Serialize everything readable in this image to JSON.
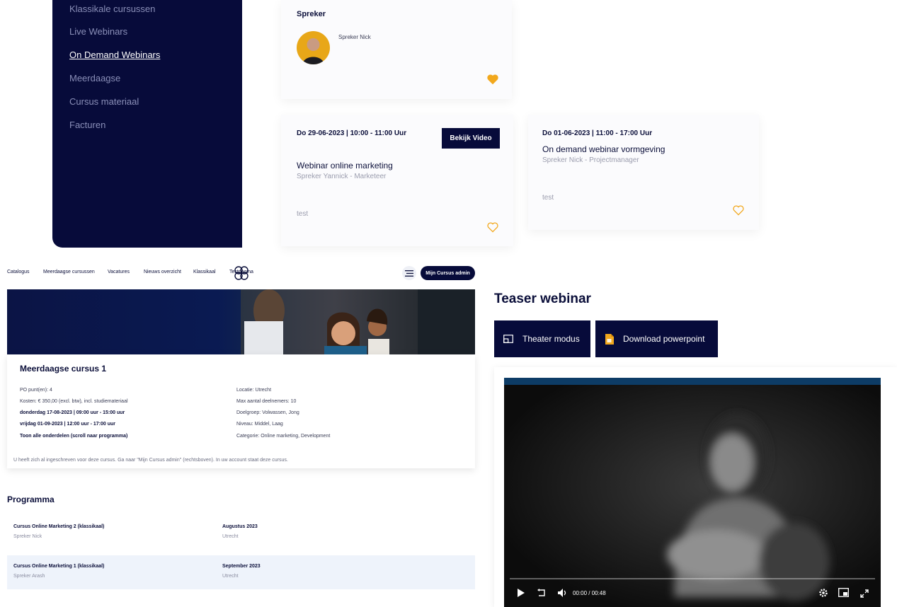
{
  "sidebar": {
    "items": [
      {
        "label": "Klassikale cursussen",
        "active": false
      },
      {
        "label": "Live Webinars",
        "active": false
      },
      {
        "label": "On Demand Webinars",
        "active": true
      },
      {
        "label": "Meerdaagse",
        "active": false
      },
      {
        "label": "Cursus materiaal",
        "active": false
      },
      {
        "label": "Facturen",
        "active": false
      }
    ]
  },
  "speaker_card": {
    "heading": "Spreker",
    "speaker_name": "Spreker Nick",
    "favorite": true
  },
  "webinar_cards": [
    {
      "date": "Do 29-06-2023 | 10:00 - 11:00 Uur",
      "button": "Bekijk Video",
      "title": "Webinar online marketing",
      "speaker": "Spreker Yannick - Marketeer",
      "description": "test",
      "favorite": false
    },
    {
      "date": "Do 01-06-2023 | 11:00 - 17:00 Uur",
      "title": "On demand webinar vormgeving",
      "speaker": "Spreker Nick - Projectmanager",
      "description": "test",
      "favorite": false
    }
  ],
  "nav": {
    "items": [
      "Catalogus",
      "Meerdaagse cursussen",
      "Vacatures",
      "Nieuws overzicht",
      "Klassikaal",
      "Testpagina"
    ],
    "admin_button": "Mijn Cursus admin"
  },
  "course": {
    "title": "Meerdaagse cursus 1",
    "left": [
      "PO punt(en): 4",
      "Kosten: € 350,00 (excl. btw), incl. studiemateriaal",
      "donderdag 17-08-2023 | 09:00 uur - 15:00 uur",
      "vrijdag 01-09-2023 | 12:00 uur - 17:00 uur",
      "Toon alle onderdelen (scroll naar programma)"
    ],
    "right": [
      "Locatie: Utrecht",
      "Max aantal deelnemers: 10",
      "Doelgroep: Volwassen, Jong",
      "Niveau: Middel, Laag",
      "Categorie: Online marketing, Development"
    ],
    "notice": "U heeft zich al ingeschreven voor deze cursus. Ga naar \"Mijn Cursus admin\" (rechtsboven). In uw account staat deze cursus."
  },
  "programma": {
    "heading": "Programma",
    "rows": [
      {
        "title": "Cursus Online Marketing 2 (klassikaal)",
        "speaker": "Spreker Nick",
        "month": "Augustus 2023",
        "location": "Utrecht",
        "highlight": false
      },
      {
        "title": "Cursus Online Marketing 1 (klassikaal)",
        "speaker": "Spreker Arash",
        "month": "September 2023",
        "location": "Utrecht",
        "highlight": true
      }
    ]
  },
  "teaser": {
    "title": "Teaser webinar",
    "theater_button": "Theater modus",
    "download_button": "Download powerpoint",
    "player": {
      "time": "00:00 / 00:48",
      "progress": 0
    }
  },
  "colors": {
    "navy": "#070b3a",
    "heart": "#f2a81d",
    "highlight_row": "#eef3fb",
    "video_topbar": "#0d3c66"
  },
  "icons": [
    "heart-filled-icon",
    "heart-outline-icon",
    "menu-icon",
    "logo-icon",
    "theater-icon",
    "file-icon",
    "play-icon",
    "replay-icon",
    "volume-icon",
    "settings-icon",
    "pip-icon",
    "fullscreen-icon"
  ]
}
